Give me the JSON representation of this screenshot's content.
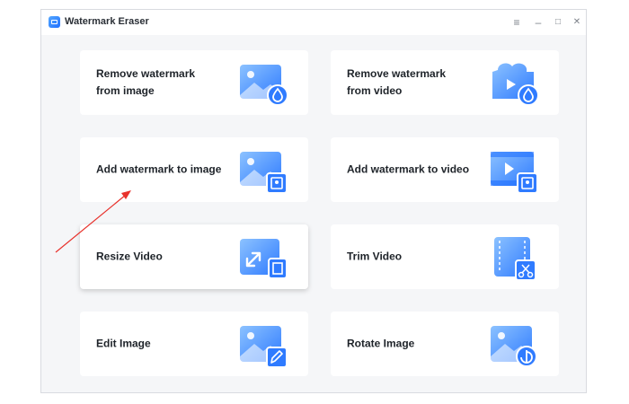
{
  "window": {
    "title": "Watermark Eraser"
  },
  "controls": {
    "menu": "≡",
    "minimize": "–",
    "maximize": "□",
    "close": "✕"
  },
  "features": {
    "remove_image": "Remove watermark from image",
    "remove_video": "Remove watermark from video",
    "add_image": "Add watermark to image",
    "add_video": "Add watermark to video",
    "resize_video": "Resize Video",
    "trim_video": "Trim Video",
    "edit_image": "Edit Image",
    "rotate_image": "Rotate Image"
  },
  "colors": {
    "accent": "#2f7bff",
    "accent_light": "#8cc2ff",
    "annotation": "#e8322c"
  }
}
